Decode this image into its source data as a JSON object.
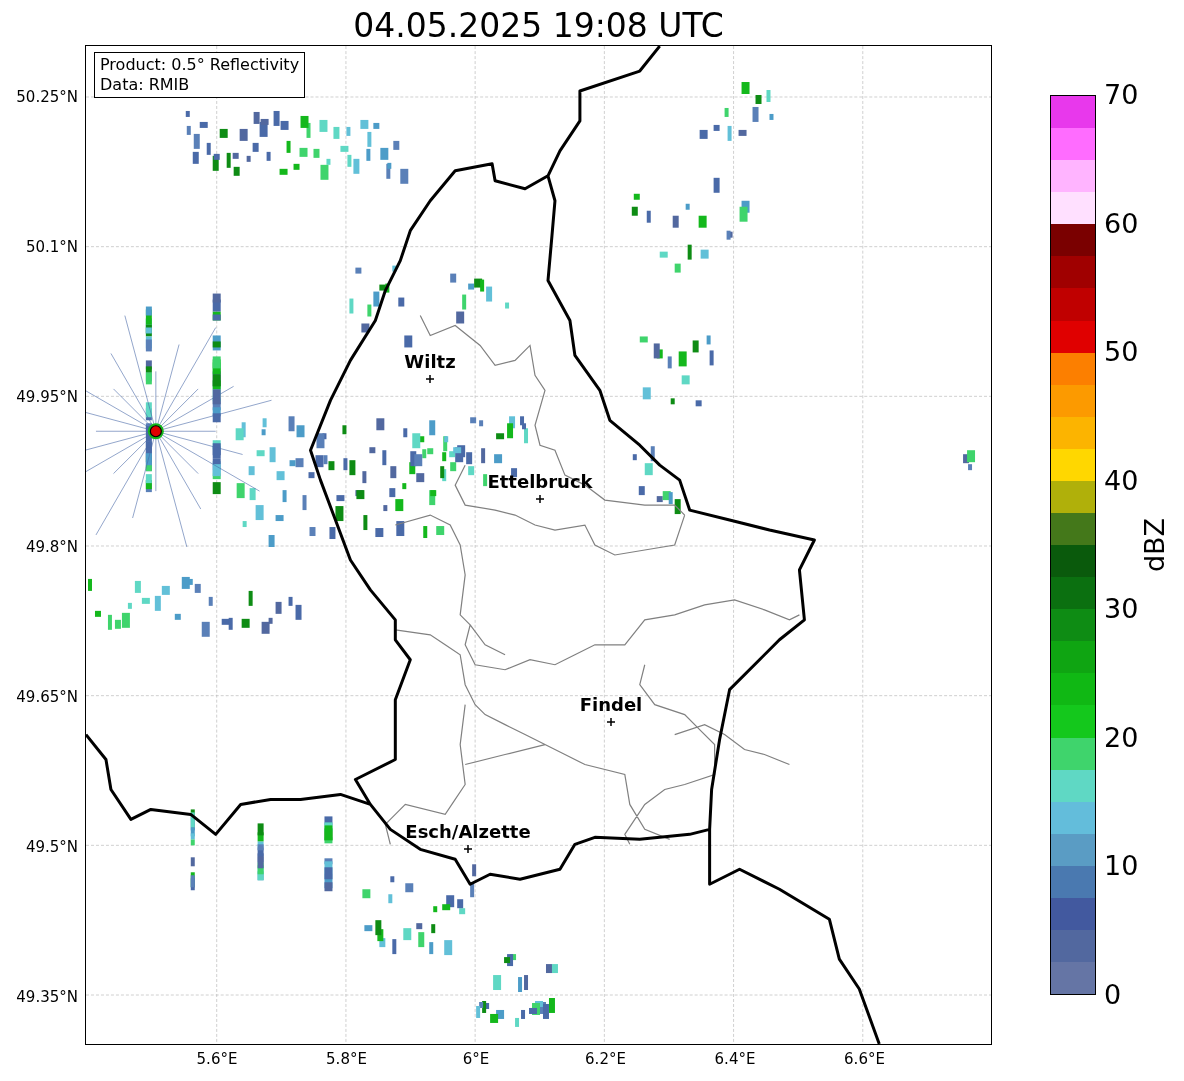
{
  "title": "04.05.2025 19:08 UTC",
  "info_box": {
    "lines": [
      "Product: 0.5° Reflectivity",
      "Data: RMIB"
    ]
  },
  "cities": [
    {
      "name": "Wiltz"
    },
    {
      "name": "Ettelbruck"
    },
    {
      "name": "Findel"
    },
    {
      "name": "Esch/Alzette"
    }
  ],
  "x_ticks": [
    "5.6°E",
    "5.8°E",
    "6°E",
    "6.2°E",
    "6.4°E",
    "6.6°E"
  ],
  "y_ticks": [
    "50.25°N",
    "50.1°N",
    "49.95°N",
    "49.8°N",
    "49.65°N",
    "49.5°N",
    "49.35°N"
  ],
  "colorbar": {
    "label": "dBZ",
    "ticks": [
      "70",
      "60",
      "50",
      "40",
      "30",
      "20",
      "10",
      "0"
    ],
    "segments": [
      {
        "color": "#6575a5"
      },
      {
        "color": "#52689f"
      },
      {
        "color": "#42599f"
      },
      {
        "color": "#4a79b0"
      },
      {
        "color": "#5a9cc4"
      },
      {
        "color": "#63bddb"
      },
      {
        "color": "#5fd8c4"
      },
      {
        "color": "#3fd46c"
      },
      {
        "color": "#14c81c"
      },
      {
        "color": "#10b814"
      },
      {
        "color": "#0fa512"
      },
      {
        "color": "#0e8c14"
      },
      {
        "color": "#0b7010"
      },
      {
        "color": "#0a5a0c"
      },
      {
        "color": "#44781a"
      },
      {
        "color": "#b0b00a"
      },
      {
        "color": "#ffd700"
      },
      {
        "color": "#fcb400"
      },
      {
        "color": "#fc9a00"
      },
      {
        "color": "#fc7f00"
      },
      {
        "color": "#e00000"
      },
      {
        "color": "#c00000"
      },
      {
        "color": "#a00000"
      },
      {
        "color": "#7a0000"
      },
      {
        "color": "#ffe0ff"
      },
      {
        "color": "#ffb4ff"
      },
      {
        "color": "#ff6cff"
      },
      {
        "color": "#e838ec"
      }
    ]
  }
}
